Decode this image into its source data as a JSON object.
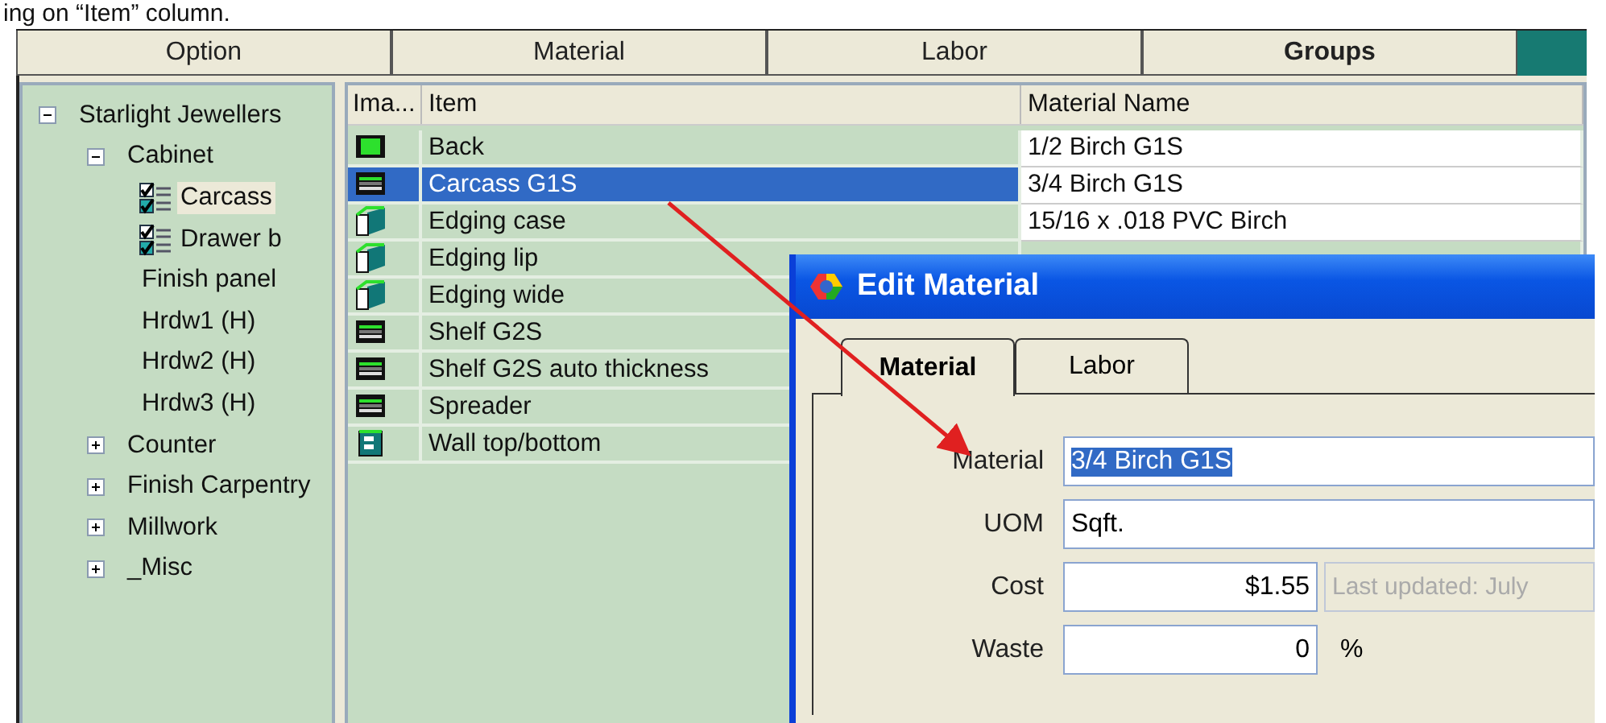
{
  "caption": "ing on “Item” column.",
  "tabs": [
    {
      "label": "Option",
      "selected": false
    },
    {
      "label": "Material",
      "selected": false
    },
    {
      "label": "Labor",
      "selected": false
    },
    {
      "label": "Groups",
      "selected": true
    }
  ],
  "tree": [
    {
      "label": "Starlight Jewellers",
      "expanded": true,
      "children": [
        {
          "label": "Cabinet",
          "expanded": true,
          "children": [
            {
              "label": "Carcass",
              "kind": "checklist",
              "selected": true
            },
            {
              "label": "Drawer b",
              "kind": "checklist",
              "selected": false
            },
            {
              "label": "Finish panel",
              "kind": "plain",
              "selected": false
            },
            {
              "label": "Hrdw1 (H)",
              "kind": "plain",
              "selected": false
            },
            {
              "label": "Hrdw2 (H)",
              "kind": "plain",
              "selected": false
            },
            {
              "label": "Hrdw3 (H)",
              "kind": "plain",
              "selected": false
            }
          ]
        },
        {
          "label": "Counter",
          "expanded": false
        },
        {
          "label": "Finish Carpentry",
          "expanded": false
        },
        {
          "label": "Millwork",
          "expanded": false
        },
        {
          "label": "_Misc",
          "expanded": false
        }
      ]
    }
  ],
  "table": {
    "columns": [
      "Ima...",
      "Item",
      "Material Name"
    ],
    "rows": [
      {
        "kind": "board-green",
        "item": "Back",
        "material": "1/2 Birch G1S",
        "selected": false
      },
      {
        "kind": "board",
        "item": "Carcass G1S",
        "material": "3/4 Birch G1S",
        "selected": true
      },
      {
        "kind": "edging",
        "item": "Edging case",
        "material": "15/16 x .018 PVC Birch",
        "selected": false
      },
      {
        "kind": "edging",
        "item": "Edging lip",
        "selected": false
      },
      {
        "kind": "edging",
        "item": "Edging wide",
        "selected": false
      },
      {
        "kind": "board",
        "item": "Shelf G2S",
        "selected": false
      },
      {
        "kind": "board",
        "item": "Shelf G2S auto thickness",
        "selected": false
      },
      {
        "kind": "board",
        "item": "Spreader",
        "selected": false
      },
      {
        "kind": "wall",
        "item": "Wall top/bottom",
        "selected": false
      }
    ]
  },
  "dialog": {
    "title": "Edit Material",
    "tabs": [
      {
        "label": "Material",
        "selected": true
      },
      {
        "label": "Labor",
        "selected": false
      }
    ],
    "fields": [
      {
        "label": "Material",
        "value": "3/4 Birch G1S",
        "kind": "selected-text"
      },
      {
        "label": "UOM",
        "value": "Sqft.",
        "kind": "text"
      },
      {
        "label": "Cost",
        "value": "$1.55",
        "kind": "amount",
        "note": "Last updated: July"
      },
      {
        "label": "Waste",
        "value": "0",
        "kind": "amount",
        "unit": "%"
      }
    ]
  }
}
